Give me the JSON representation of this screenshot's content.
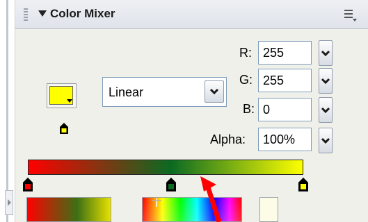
{
  "panel": {
    "title": "Color Mixer"
  },
  "fill": {
    "swatch_color": "#ffff00",
    "type": "Linear"
  },
  "fields": {
    "r_label": "R:",
    "r_value": "255",
    "g_label": "G:",
    "g_value": "255",
    "b_label": "B:",
    "b_value": "0",
    "alpha_label": "Alpha:",
    "alpha_value": "100%"
  },
  "gradient": {
    "stops": [
      {
        "color": "#ff0000",
        "position": 0.0
      },
      {
        "color": "#0a6a22",
        "position": 0.52
      },
      {
        "color": "#ffff00",
        "position": 1.0
      }
    ],
    "selected_stop": 2
  },
  "annotation": {
    "arrow_color": "#ff0000"
  },
  "icons": {
    "collapse": "triangle-down-icon",
    "options": "panel-options-icon",
    "pointer": "pointer-icon",
    "dropdown": "chevron-down-icon",
    "crosshair": "crosshair-icon"
  }
}
